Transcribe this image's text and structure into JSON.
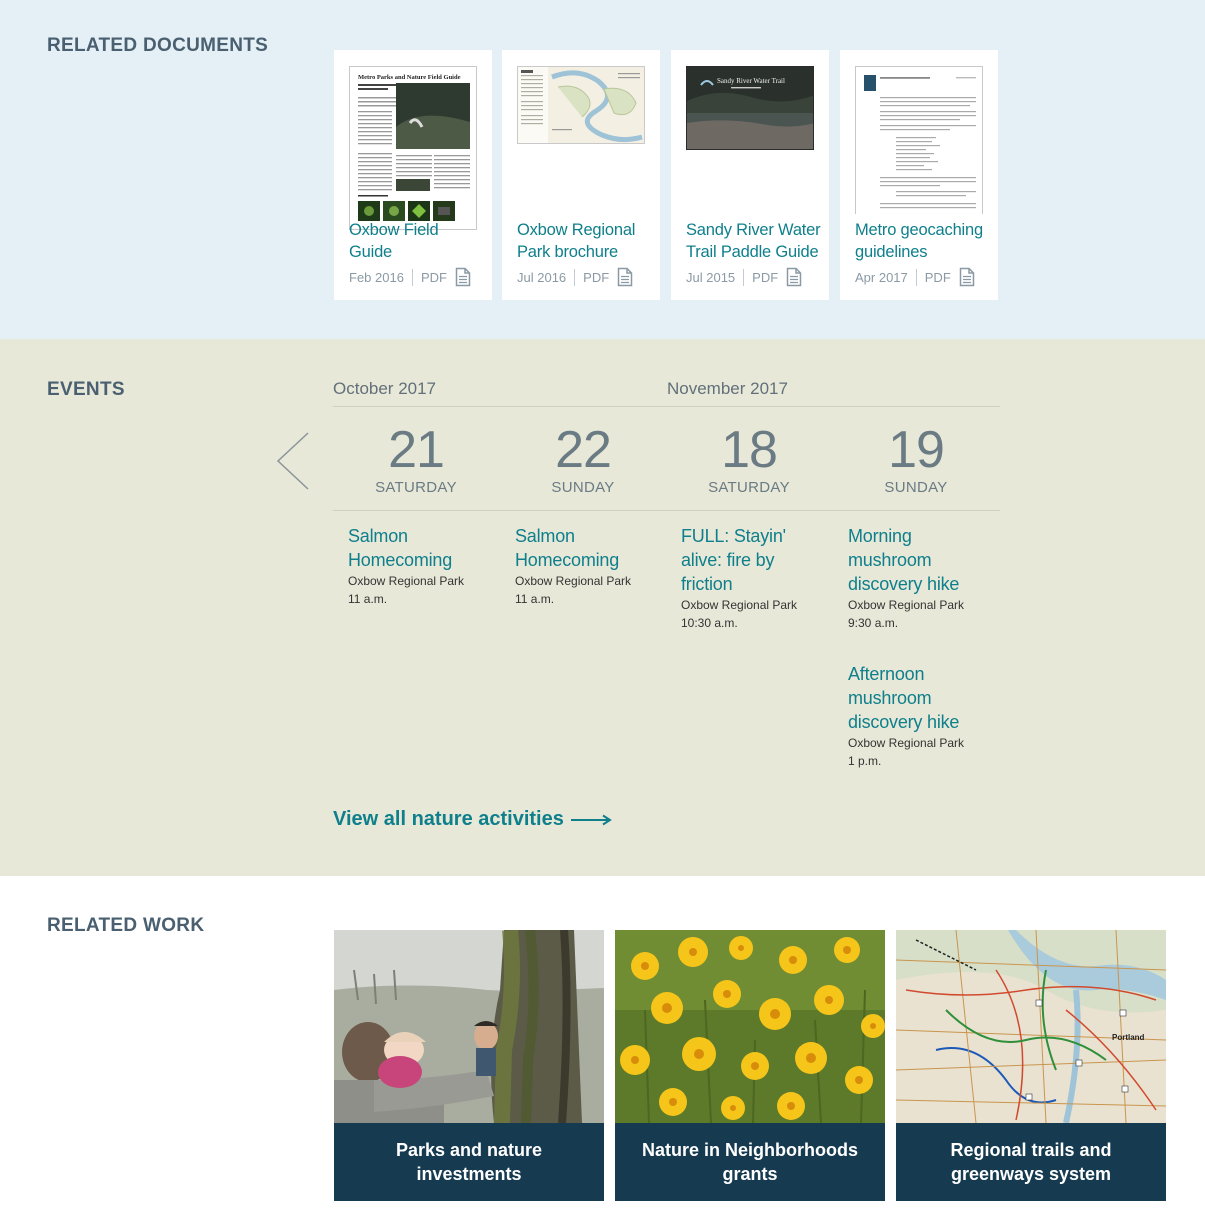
{
  "related_documents": {
    "heading": "RELATED DOCUMENTS",
    "items": [
      {
        "title": "Oxbow Field Guide",
        "date": "Feb 2016",
        "type": "PDF",
        "icon": "pdf-document-icon",
        "thumb_heading": "Metro Parks and Nature Field Guide"
      },
      {
        "title": "Oxbow Regional Park brochure",
        "date": "Jul 2016",
        "type": "PDF",
        "icon": "pdf-document-icon"
      },
      {
        "title": "Sandy River Water Trail Paddle Guide",
        "date": "Jul 2015",
        "type": "PDF",
        "icon": "pdf-document-icon",
        "thumb_heading": "Sandy River Water Trail"
      },
      {
        "title": "Metro geocaching guidelines",
        "date": "Apr 2017",
        "type": "PDF",
        "icon": "pdf-document-icon"
      }
    ]
  },
  "events": {
    "heading": "EVENTS",
    "months": [
      "October 2017",
      "November 2017"
    ],
    "days": [
      {
        "num": "21",
        "name": "SATURDAY",
        "events": [
          {
            "title": "Salmon Homecoming",
            "location": "Oxbow Regional Park",
            "time": "11 a.m."
          }
        ]
      },
      {
        "num": "22",
        "name": "SUNDAY",
        "events": [
          {
            "title": "Salmon Homecoming",
            "location": "Oxbow Regional Park",
            "time": "11 a.m."
          }
        ]
      },
      {
        "num": "18",
        "name": "SATURDAY",
        "events": [
          {
            "title": "FULL: Stayin' alive: fire by friction",
            "location": "Oxbow Regional Park",
            "time": "10:30 a.m."
          }
        ]
      },
      {
        "num": "19",
        "name": "SUNDAY",
        "events": [
          {
            "title": "Morning mushroom discovery hike",
            "location": "Oxbow Regional Park",
            "time": "9:30 a.m."
          },
          {
            "title": "Afternoon mushroom discovery hike",
            "location": "Oxbow Regional Park",
            "time": "1 p.m."
          }
        ]
      }
    ],
    "view_all": "View all nature activities",
    "prev_icon": "chevron-left-icon",
    "arrow_icon": "long-arrow-right-icon"
  },
  "related_work": {
    "heading": "RELATED WORK",
    "items": [
      {
        "title": "Parks and nature investments"
      },
      {
        "title": "Nature in Neighborhoods grants"
      },
      {
        "title": "Regional trails and greenways system",
        "map_label": "Portland"
      }
    ]
  },
  "colors": {
    "docs_bg": "#e4f0f6",
    "events_bg": "#e8e8d9",
    "link_teal": "#0e7f8b",
    "heading_slate": "#4a6070",
    "caption_navy": "#163a50"
  }
}
